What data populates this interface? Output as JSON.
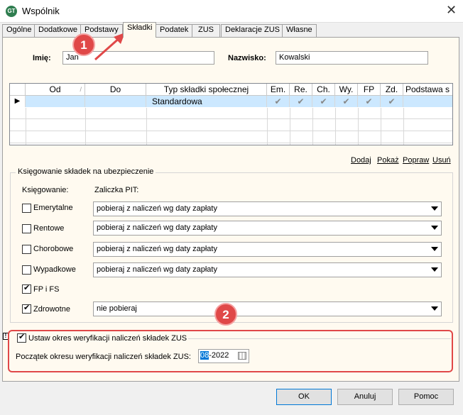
{
  "window": {
    "title": "Wspólnik",
    "icon_text": "GT"
  },
  "tabs": [
    "Ogólne",
    "Dodatkowe",
    "Podstawy",
    "Składki",
    "Podatek",
    "ZUS",
    "Deklaracje ZUS",
    "Własne"
  ],
  "active_tab": "Składki",
  "form": {
    "first_name_label": "Imię:",
    "first_name_value": "Jan",
    "last_name_label": "Nazwisko:",
    "last_name_value": "Kowalski"
  },
  "grid": {
    "columns": [
      "Od",
      "Do",
      "Typ składki społecznej",
      "Em.",
      "Re.",
      "Ch.",
      "Wy.",
      "FP",
      "Zd.",
      "Podstawa s"
    ],
    "sort_indicator": "/",
    "rows": [
      {
        "od": "",
        "do": "",
        "typ": "Standardowa",
        "checks": [
          "✔",
          "✔",
          "✔",
          "✔",
          "✔",
          "✔"
        ],
        "row_marker": "▶"
      }
    ]
  },
  "links": {
    "add": "Dodaj",
    "show": "Pokaż",
    "edit": "Popraw",
    "delete": "Usuń"
  },
  "group": {
    "title": "Księgowanie składek na ubezpieczenie",
    "col1": "Księgowanie:",
    "col2": "Zaliczka PIT:",
    "items": [
      {
        "label": "Emerytalne",
        "checked": false,
        "pit": "pobieraj z naliczeń wg daty zapłaty"
      },
      {
        "label": "Rentowe",
        "checked": false,
        "pit": "pobieraj z naliczeń wg daty zapłaty"
      },
      {
        "label": "Chorobowe",
        "checked": false,
        "pit": "pobieraj z naliczeń wg daty zapłaty"
      },
      {
        "label": "Wypadkowe",
        "checked": false,
        "pit": "pobieraj z naliczeń wg daty zapłaty"
      },
      {
        "label": "FP i FS",
        "checked": true
      },
      {
        "label": "Zdrowotne",
        "checked": true,
        "pit": "nie pobieraj"
      }
    ]
  },
  "verification": {
    "checkbox_label": "Ustaw okres weryfikacji naliczeń składek ZUS",
    "checked": true,
    "start_label": "Początek okresu weryfikacji naliczeń składek ZUS:",
    "month": "08",
    "year": "-2022",
    "marker": "!"
  },
  "callouts": [
    "1",
    "2"
  ],
  "buttons": {
    "ok": "OK",
    "cancel": "Anuluj",
    "help": "Pomoc"
  },
  "colors": {
    "callout": "#e04848",
    "selection": "#cce8ff",
    "panel": "#fffaf0"
  }
}
